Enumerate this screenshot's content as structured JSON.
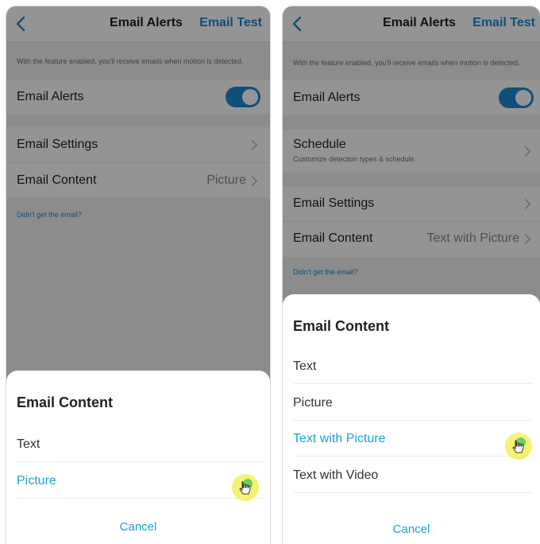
{
  "colors": {
    "accent": "#1a8ad1",
    "selected": "#1aa3d8",
    "toggle_on": "#1a8ad1",
    "overlay": "rgba(0,0,0,0.42)"
  },
  "left": {
    "nav": {
      "title": "Email Alerts",
      "action": "Email Test",
      "back_icon": "chevron-left-icon"
    },
    "description": "With the feature enabled, you'll receive emails when motion is detected.",
    "email_alerts": {
      "label": "Email Alerts",
      "enabled": true
    },
    "email_settings": {
      "label": "Email Settings"
    },
    "email_content": {
      "label": "Email Content",
      "value": "Picture"
    },
    "help_link": "Didn't get the email?",
    "sheet": {
      "title": "Email Content",
      "options": [
        {
          "label": "Text",
          "selected": false
        },
        {
          "label": "Picture",
          "selected": true
        }
      ],
      "cancel": "Cancel"
    }
  },
  "right": {
    "nav": {
      "title": "Email Alerts",
      "action": "Email Test",
      "back_icon": "chevron-left-icon"
    },
    "description": "With the feature enabled, you'll receive emails when motion is detected.",
    "email_alerts": {
      "label": "Email Alerts",
      "enabled": true
    },
    "schedule": {
      "label": "Schedule",
      "sub": "Customize detection types & schedule."
    },
    "email_settings": {
      "label": "Email Settings"
    },
    "email_content": {
      "label": "Email Content",
      "value": "Text with Picture"
    },
    "help_link": "Didn't get the email?",
    "sheet": {
      "title": "Email Content",
      "options": [
        {
          "label": "Text",
          "selected": false
        },
        {
          "label": "Picture",
          "selected": false
        },
        {
          "label": "Text with Picture",
          "selected": true
        },
        {
          "label": "Text with Video",
          "selected": false
        }
      ],
      "cancel": "Cancel"
    }
  }
}
